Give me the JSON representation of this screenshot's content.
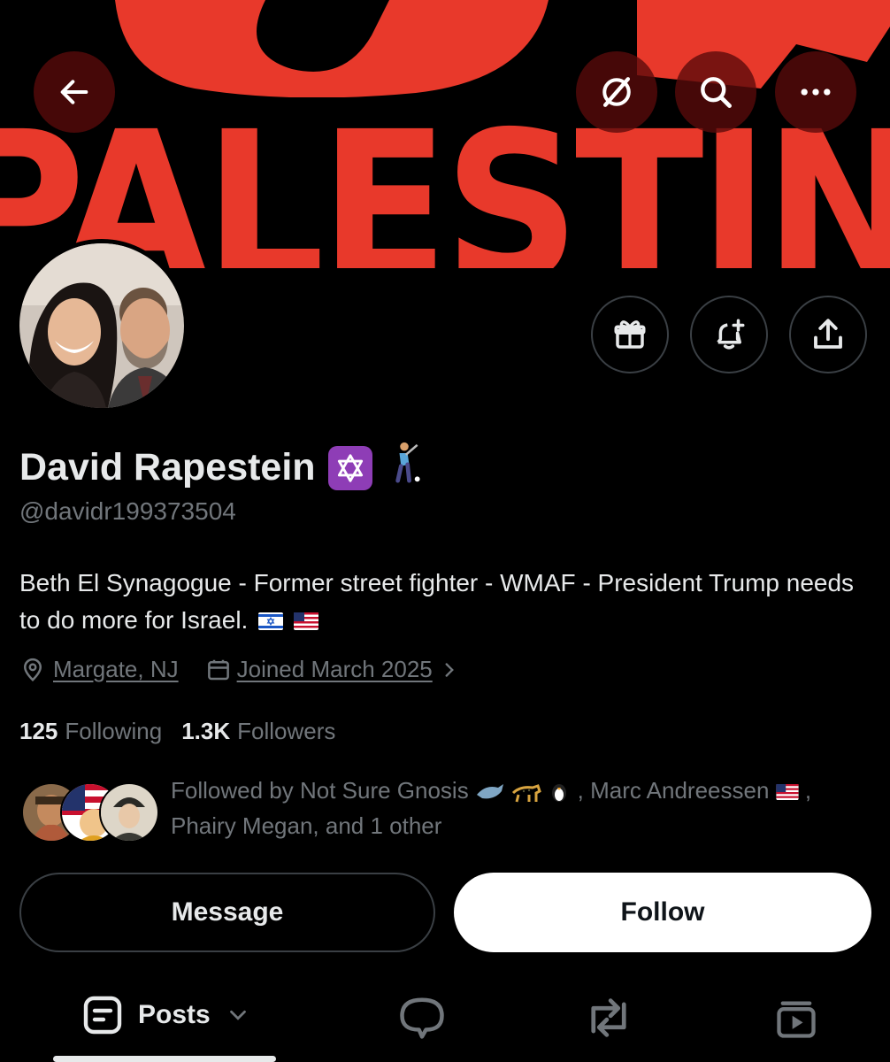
{
  "banner": {
    "text": "PALESTINE"
  },
  "header": {
    "back_icon": "arrow-left-icon",
    "grok_icon": "grok-icon",
    "search_icon": "search-icon",
    "more_icon": "more-horizontal-icon"
  },
  "actions": {
    "gift_icon": "gift-icon",
    "notify_icon": "bell-plus-icon",
    "share_icon": "share-icon"
  },
  "profile": {
    "name": "David Rapestein",
    "handle": "@davidr199373504",
    "bio": "Beth El Synagogue - Former street fighter - WMAF - President Trump needs to do more for Israel.",
    "location": "Margate, NJ",
    "joined": "Joined March 2025"
  },
  "stats": {
    "following_count": "125",
    "following_label": "Following",
    "followers_count": "1.3K",
    "followers_label": "Followers"
  },
  "followed_by": {
    "prefix": "Followed by Not Sure Gnosis",
    "middle": ", Marc Andreessen",
    "suffix": ", Phairy Megan, and 1 other"
  },
  "buttons": {
    "message": "Message",
    "follow": "Follow"
  },
  "tabs": {
    "posts": "Posts"
  },
  "colors": {
    "background": "#000000",
    "banner_red": "#e8392b",
    "text_primary": "#e7e9ea",
    "text_secondary": "#71767b",
    "border": "#3a3f44",
    "follow_bg": "#ffffff"
  }
}
